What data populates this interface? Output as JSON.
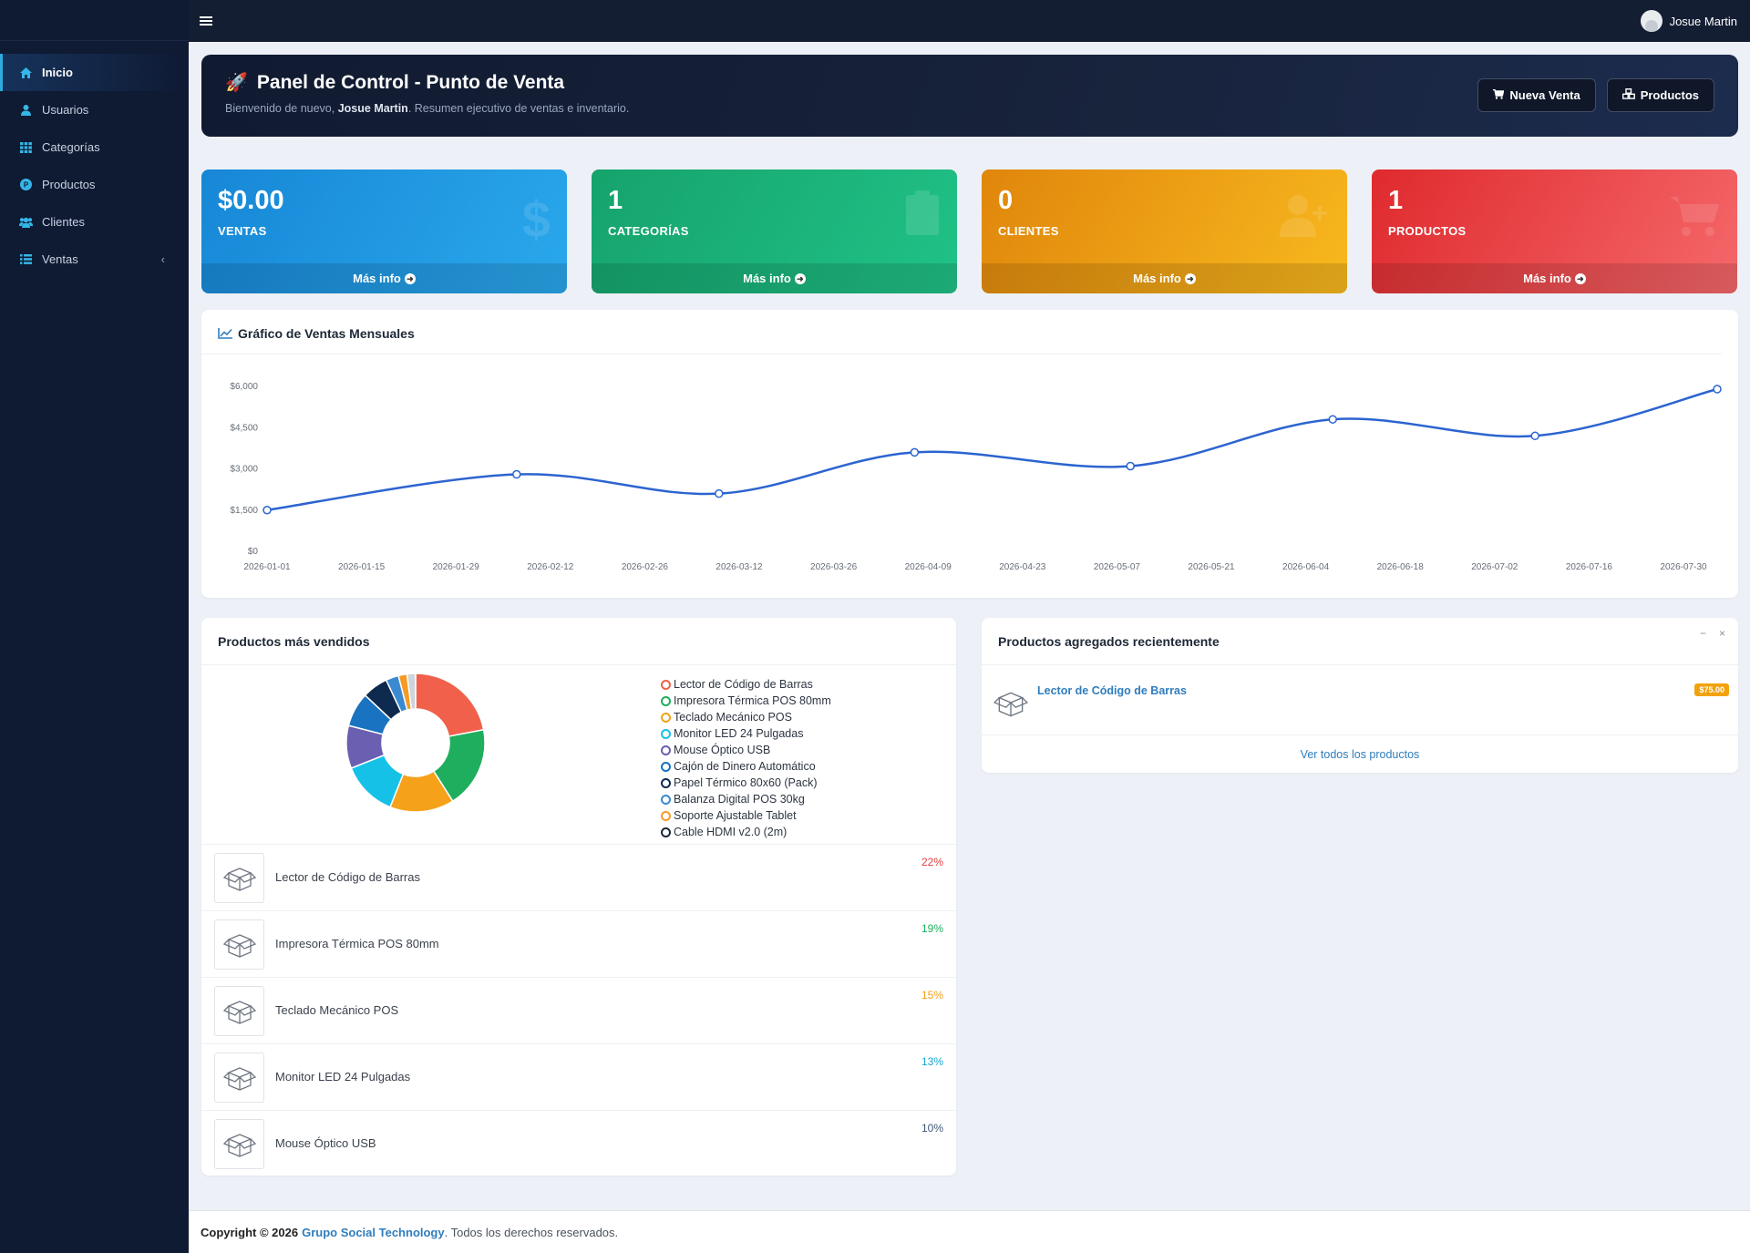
{
  "topbar": {
    "user_name": "Josue Martin"
  },
  "sidebar": {
    "items": [
      {
        "label": "Inicio",
        "icon": "home-icon",
        "active": true
      },
      {
        "label": "Usuarios",
        "icon": "user-icon"
      },
      {
        "label": "Categorías",
        "icon": "grid-icon"
      },
      {
        "label": "Productos",
        "icon": "product-badge-icon"
      },
      {
        "label": "Clientes",
        "icon": "users-icon"
      },
      {
        "label": "Ventas",
        "icon": "list-icon",
        "caret": "‹"
      }
    ]
  },
  "hero": {
    "title": "Panel de Control - Punto de Venta",
    "subtitle_prefix": "Bienvenido de nuevo,",
    "subtitle_user": "Josue Martin",
    "subtitle_suffix": ". Resumen ejecutivo de ventas e inventario.",
    "btn_new_sale": "Nueva Venta",
    "btn_products": "Productos"
  },
  "stats": [
    {
      "value": "$0.00",
      "label": "VENTAS",
      "more": "Más info",
      "color": "#1e96e0",
      "icon": "dollar-icon"
    },
    {
      "value": "1",
      "label": "CATEGORÍAS",
      "more": "Más info",
      "color": "#19b27a",
      "icon": "clipboard-icon"
    },
    {
      "value": "0",
      "label": "CLIENTES",
      "more": "Más info",
      "color": "#ee9f15",
      "icon": "user-plus-icon"
    },
    {
      "value": "1",
      "label": "PRODUCTOS",
      "more": "Más info",
      "color": "#e8393c",
      "icon": "cart-icon"
    }
  ],
  "sales_chart": {
    "title": "Gráfico de Ventas Mensuales"
  },
  "chart_data": [
    {
      "type": "line",
      "title": "Gráfico de Ventas Mensuales",
      "xlabel": "",
      "ylabel": "",
      "y_ticks": [
        "$0",
        "$1,500",
        "$3,000",
        "$4,500",
        "$6,000"
      ],
      "ylim": [
        0,
        6000
      ],
      "x_ticks": [
        "2026-01-01",
        "2026-01-15",
        "2026-01-29",
        "2026-02-12",
        "2026-02-26",
        "2026-03-12",
        "2026-03-26",
        "2026-04-09",
        "2026-04-23",
        "2026-05-07",
        "2026-05-21",
        "2026-06-04",
        "2026-06-18",
        "2026-07-02",
        "2026-07-16",
        "2026-07-30"
      ],
      "x_range": [
        "2026-01-01",
        "2026-07-30"
      ],
      "points": [
        {
          "x": "2026-01-01",
          "y": 1500
        },
        {
          "x": "2026-02-07",
          "y": 2800
        },
        {
          "x": "2026-03-09",
          "y": 2100
        },
        {
          "x": "2026-04-07",
          "y": 3600
        },
        {
          "x": "2026-05-09",
          "y": 3100
        },
        {
          "x": "2026-06-08",
          "y": 4800
        },
        {
          "x": "2026-07-08",
          "y": 4200
        },
        {
          "x": "2026-08-04",
          "y": 5900
        }
      ],
      "color": "#2c64d0",
      "grid": false
    },
    {
      "type": "pie",
      "title": "Productos más vendidos",
      "legend_position": "right",
      "slices": [
        {
          "label": "Lector de Código de Barras",
          "value": 22,
          "color": "#f0604a"
        },
        {
          "label": "Impresora Térmica POS 80mm",
          "value": 19,
          "color": "#1fae5e"
        },
        {
          "label": "Teclado Mecánico POS",
          "value": 15,
          "color": "#f5a21a"
        },
        {
          "label": "Monitor LED 24 Pulgadas",
          "value": 13,
          "color": "#16c1e8"
        },
        {
          "label": "Mouse Óptico USB",
          "value": 10,
          "color": "#6a5fb0"
        },
        {
          "label": "Cajón de Dinero Automático",
          "value": 8,
          "color": "#1a73c0"
        },
        {
          "label": "Papel Térmico 80x60 (Pack)",
          "value": 6,
          "color": "#0e2a4e"
        },
        {
          "label": "Balanza Digital POS 30kg",
          "value": 3,
          "color": "#3b8ad1"
        },
        {
          "label": "Soporte Ajustable Tablet",
          "value": 2,
          "color": "#f59b25"
        },
        {
          "label": "Cable HDMI v2.0 (2m)",
          "value": 2,
          "color": "#d0d4da"
        }
      ]
    }
  ],
  "top_products": {
    "title": "Productos más vendidos",
    "legend": [
      {
        "label": "Lector de Código de Barras",
        "color": "#f0604a"
      },
      {
        "label": "Impresora Térmica POS 80mm",
        "color": "#1fae5e"
      },
      {
        "label": "Teclado Mecánico POS",
        "color": "#f5a21a"
      },
      {
        "label": "Monitor LED 24 Pulgadas",
        "color": "#16c1e8"
      },
      {
        "label": "Mouse Óptico USB",
        "color": "#6a5fb0"
      },
      {
        "label": "Cajón de Dinero Automático",
        "color": "#1a73c0"
      },
      {
        "label": "Papel Térmico 80x60 (Pack)",
        "color": "#0e2a4e"
      },
      {
        "label": "Balanza Digital POS 30kg",
        "color": "#3b8ad1"
      },
      {
        "label": "Soporte Ajustable Tablet",
        "color": "#f59b25"
      },
      {
        "label": "Cable HDMI v2.0 (2m)",
        "color": "#1e2836"
      }
    ],
    "rows": [
      {
        "name": "Lector de Código de Barras",
        "pct": "22%",
        "color": "#e53e3e"
      },
      {
        "name": "Impresora Térmica POS 80mm",
        "pct": "19%",
        "color": "#1fae5e"
      },
      {
        "name": "Teclado Mecánico POS",
        "pct": "15%",
        "color": "#f0a01a"
      },
      {
        "name": "Monitor LED 24 Pulgadas",
        "pct": "13%",
        "color": "#17a7cf"
      },
      {
        "name": "Mouse Óptico USB",
        "pct": "10%",
        "color": "#3f5878"
      }
    ]
  },
  "recent_products": {
    "title": "Productos agregados recientemente",
    "minimize": "−",
    "close": "×",
    "items": [
      {
        "name": "Lector de Código de Barras",
        "price": "$75.00"
      }
    ],
    "view_all": "Ver todos los productos"
  },
  "footer": {
    "copyright": "Copyright © 2026",
    "company": "Grupo Social Technology",
    "rights": ". Todos los derechos reservados."
  }
}
